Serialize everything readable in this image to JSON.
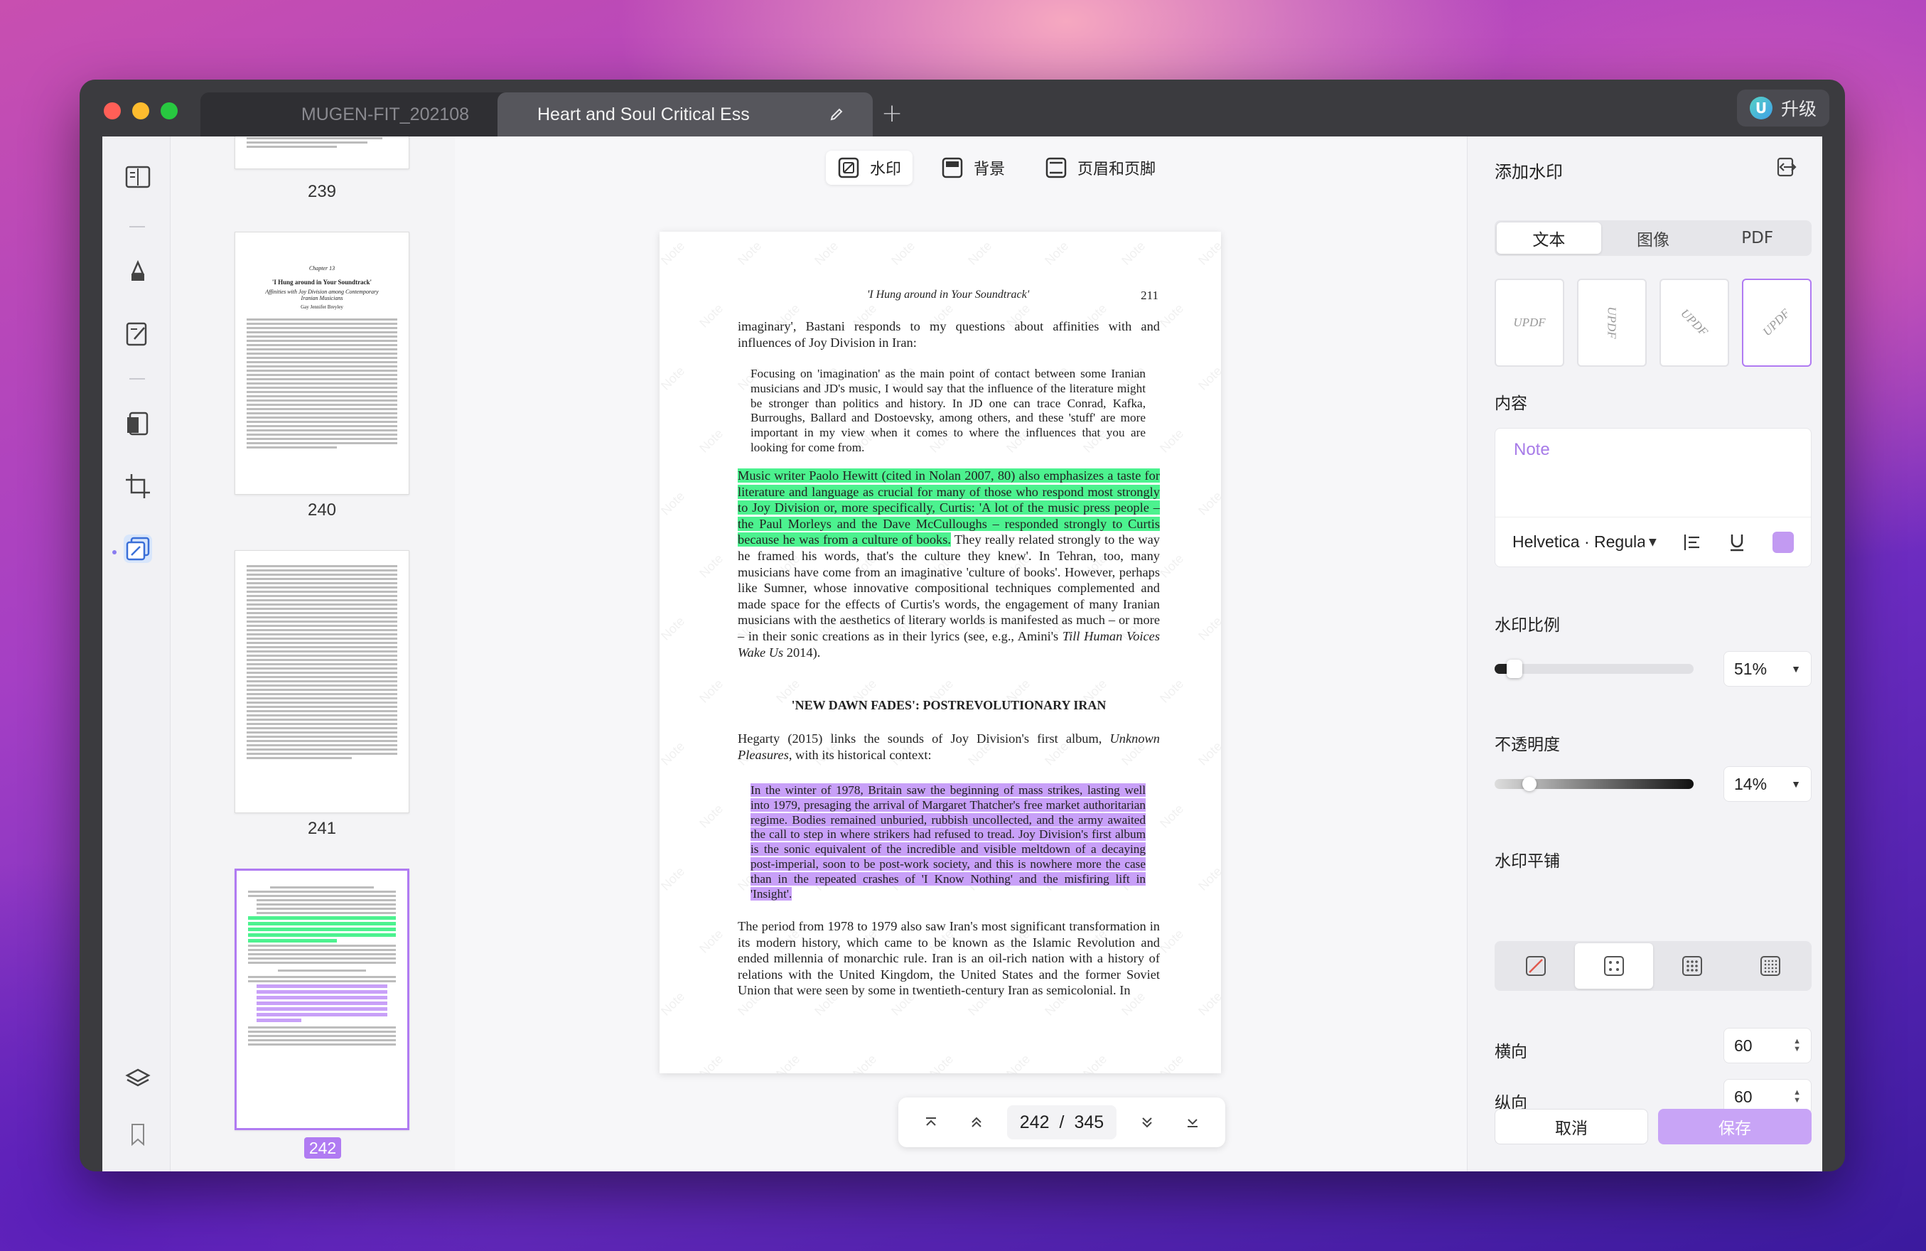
{
  "tabs": [
    {
      "label": "MUGEN-FIT_202108"
    },
    {
      "label": "Heart and Soul Critical Ess"
    }
  ],
  "upgrade": {
    "logo": "U",
    "label": "升级"
  },
  "toolbar": {
    "watermark": "水印",
    "background": "背景",
    "header_footer": "页眉和页脚"
  },
  "thumbnails": [
    {
      "page": "239"
    },
    {
      "page": "240",
      "chapter": "Chapter 13",
      "title": "'I Hung around in Your Soundtrack'",
      "subtitle": "Affinities with Joy Division among Contemporary Iranian Musicians",
      "author": "Gay Jennifer Breyley"
    },
    {
      "page": "241"
    },
    {
      "page": "242"
    }
  ],
  "document": {
    "running_head": "'I Hung around in Your Soundtrack'",
    "page_number": "211",
    "p1": "imaginary', Bastani responds to my questions about affinities with and influences of Joy Division in Iran:",
    "q1": "Focusing on 'imagination' as the main point of contact between some Iranian musicians and JD's music, I would say that the influence of the literature might be stronger than politics and history. In JD one can trace Conrad, Kafka, Burroughs, Ballard and Dostoevsky, among others, and these 'stuff' are more important in my view when it comes to where the influences that you are looking for come from.",
    "p2_highlight": "Music writer Paolo Hewitt (cited in Nolan 2007, 80) also emphasizes a taste for literature and language as crucial for many of those who respond most strongly to Joy Division or, more specifically, Curtis: 'A lot of the music press people – the Paul Morleys and the Dave McCulloughs – responded strongly to Curtis because he was from a culture of books.",
    "p2_rest": " They really related strongly to the way he framed his words, that's the culture they knew'. In Tehran, too, many musicians have come from an imaginative 'culture of books'. However, perhaps like Sumner, whose innovative compositional techniques complemented and made space for the effects of Curtis's words, the engagement of many Iranian musicians with the aesthetics of literary worlds is manifested as much – or more – in their sonic creations as in their lyrics (see, e.g., Amini's ",
    "p2_italic": "Till Human Voices Wake Us",
    "p2_end": " 2014).",
    "section_heading": "'NEW DAWN FADES': POSTREVOLUTIONARY IRAN",
    "p3_start": "Hegarty (2015) links the sounds of Joy Division's first album, ",
    "p3_italic": "Unknown Pleasures",
    "p3_end": ", with its historical context:",
    "q2_highlight": "In the winter of 1978, Britain saw the beginning of mass strikes, lasting well into 1979, presaging the arrival of Margaret Thatcher's free market authoritarian regime. Bodies remained unburied, rubbish uncollected, and the army awaited the call to step in where strikers had refused to tread. Joy Division's first album is the sonic equivalent of the incredible and visible meltdown of a decaying post-imperial, soon to be post-work society, and this is nowhere more the case than in the repeated crashes of 'I Know Nothing' and the misfiring lift in 'Insight'.",
    "p4": "The period from 1978 to 1979 also saw Iran's most significant transformation in its modern history, which came to be known as the Islamic Revolution and ended millennia of monarchic rule. Iran is an oil-rich nation with a history of relations with the United Kingdom, the United States and the former Soviet Union that were seen by some in twentieth-century Iran as semicolonial. In",
    "watermark_text": "Note"
  },
  "pager": {
    "current": "242",
    "separator": "/",
    "total": "345"
  },
  "panel": {
    "title": "添加水印",
    "tabs": [
      "文本",
      "图像",
      "PDF"
    ],
    "style_sample": "UPDF",
    "content_label": "内容",
    "content_value": "Note",
    "font": "Helvetica · Regular",
    "scale_label": "水印比例",
    "scale_value": "51%",
    "scale_fraction": 0.06,
    "opacity_label": "不透明度",
    "opacity_value": "14%",
    "opacity_fraction": 0.14,
    "tiling_label": "水印平铺",
    "horizontal_label": "横向",
    "horizontal_value": "60",
    "vertical_label": "纵向",
    "vertical_value": "60",
    "cancel": "取消",
    "save": "保存",
    "accent_color": "#c29af2"
  }
}
